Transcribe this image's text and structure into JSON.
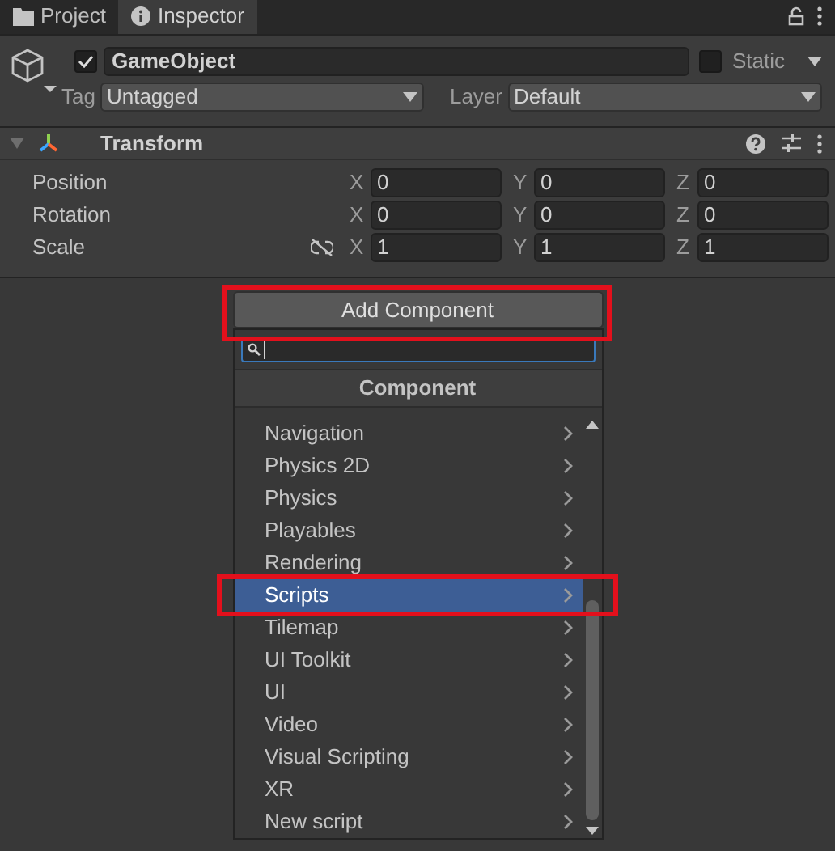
{
  "tabs": [
    {
      "label": "Project",
      "selected": false
    },
    {
      "label": "Inspector",
      "selected": true
    }
  ],
  "object": {
    "active": true,
    "name": "GameObject",
    "static": false,
    "static_label": "Static",
    "tag_label": "Tag",
    "tag": "Untagged",
    "layer_label": "Layer",
    "layer": "Default"
  },
  "transform": {
    "title": "Transform",
    "expanded": true,
    "rows": [
      {
        "label": "Position",
        "kind": "vector",
        "axes": [
          "X",
          "Y",
          "Z"
        ],
        "values": [
          "0",
          "0",
          "0"
        ]
      },
      {
        "label": "Rotation",
        "kind": "vector",
        "axes": [
          "X",
          "Y",
          "Z"
        ],
        "values": [
          "0",
          "0",
          "0"
        ]
      },
      {
        "label": "Scale",
        "kind": "scale",
        "axes": [
          "X",
          "Y",
          "Z"
        ],
        "values": [
          "1",
          "1",
          "1"
        ]
      }
    ]
  },
  "add_component": {
    "label": "Add Component",
    "highlighted": true
  },
  "dropdown": {
    "title": "Component",
    "items": [
      {
        "label": "Navigation",
        "selected": false,
        "highlighted": false
      },
      {
        "label": "Physics 2D",
        "selected": false,
        "highlighted": false
      },
      {
        "label": "Physics",
        "selected": false,
        "highlighted": false
      },
      {
        "label": "Playables",
        "selected": false,
        "highlighted": false
      },
      {
        "label": "Rendering",
        "selected": false,
        "highlighted": false
      },
      {
        "label": "Scripts",
        "selected": true,
        "highlighted": true
      },
      {
        "label": "Tilemap",
        "selected": false,
        "highlighted": false
      },
      {
        "label": "UI Toolkit",
        "selected": false,
        "highlighted": false
      },
      {
        "label": "UI",
        "selected": false,
        "highlighted": false
      },
      {
        "label": "Video",
        "selected": false,
        "highlighted": false
      },
      {
        "label": "Visual Scripting",
        "selected": false,
        "highlighted": false
      },
      {
        "label": "XR",
        "selected": false,
        "highlighted": false
      },
      {
        "label": "New script",
        "selected": false,
        "highlighted": false
      }
    ]
  }
}
